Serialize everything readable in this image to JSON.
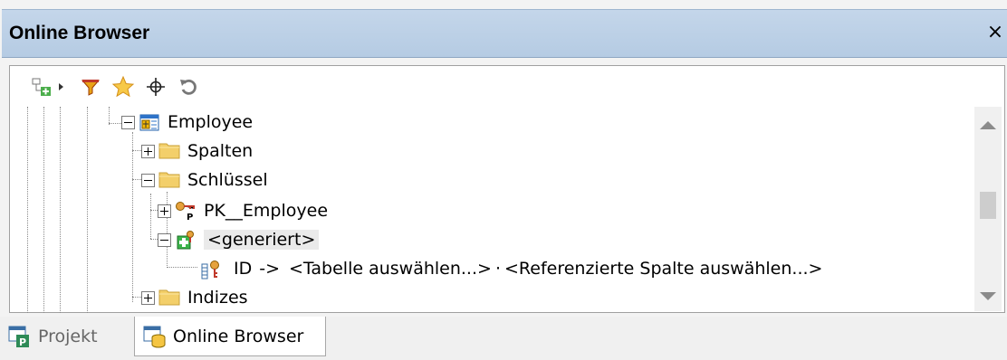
{
  "window": {
    "title": "Online Browser",
    "close_glyph": "×"
  },
  "toolbar": {
    "buttons": [
      {
        "name": "add-object-icon"
      },
      {
        "name": "dropdown-arrow-icon"
      },
      {
        "name": "filter-icon"
      },
      {
        "name": "favorites-star-icon"
      },
      {
        "name": "locate-crosshair-icon"
      },
      {
        "name": "refresh-icon"
      }
    ]
  },
  "tree": {
    "employee": "Employee",
    "spalten": "Spalten",
    "schluessel": "Schlüssel",
    "pk": "PK__Employee",
    "generiert": "<generiert>",
    "id_col": "ID",
    "id_arrow": "->",
    "table_select": "<Tabelle auswählen...>",
    "dot": "·",
    "ref_select": "<Referenzierte Spalte auswählen...>",
    "indizes": "Indizes"
  },
  "tabs": {
    "projekt": "Projekt",
    "online_browser": "Online Browser"
  },
  "colors": {
    "titlebar": "#b9cee6",
    "folder": "#f3cf6a",
    "key_green": "#3bb54a"
  }
}
